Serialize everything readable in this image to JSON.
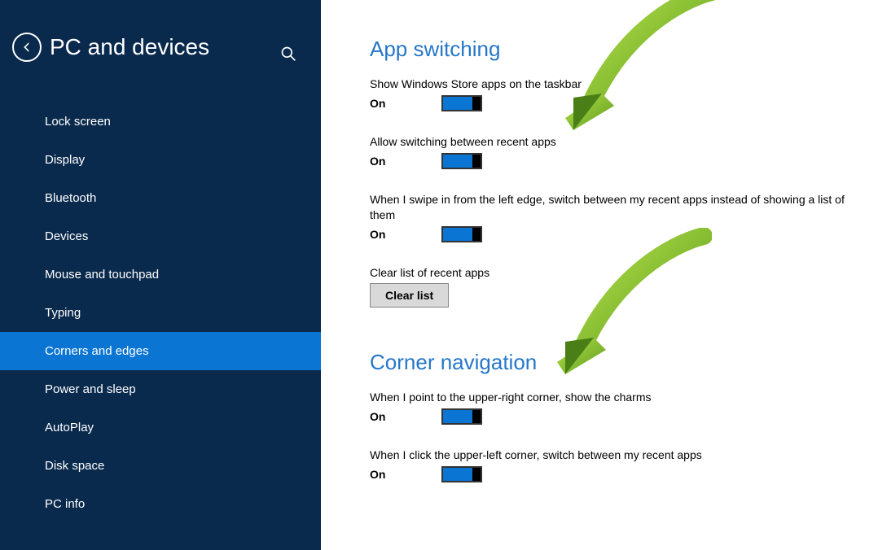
{
  "header": {
    "title": "PC and devices"
  },
  "sidebar": {
    "items": [
      {
        "label": "Lock screen"
      },
      {
        "label": "Display"
      },
      {
        "label": "Bluetooth"
      },
      {
        "label": "Devices"
      },
      {
        "label": "Mouse and touchpad"
      },
      {
        "label": "Typing"
      },
      {
        "label": "Corners and edges",
        "active": true
      },
      {
        "label": "Power and sleep"
      },
      {
        "label": "AutoPlay"
      },
      {
        "label": "Disk space"
      },
      {
        "label": "PC info"
      }
    ]
  },
  "sections": {
    "app_switching": {
      "title": "App switching",
      "settings": [
        {
          "label": "Show Windows Store apps on the taskbar",
          "state": "On"
        },
        {
          "label": "Allow switching between recent apps",
          "state": "On"
        },
        {
          "label": "When I swipe in from the left edge, switch between my recent apps instead of showing a list of them",
          "state": "On"
        }
      ],
      "clear": {
        "label": "Clear list of recent apps",
        "button": "Clear list"
      }
    },
    "corner_navigation": {
      "title": "Corner navigation",
      "settings": [
        {
          "label": "When I point to the upper-right corner, show the charms",
          "state": "On"
        },
        {
          "label": "When I click the upper-left corner, switch between my recent apps",
          "state": "On"
        }
      ]
    }
  }
}
